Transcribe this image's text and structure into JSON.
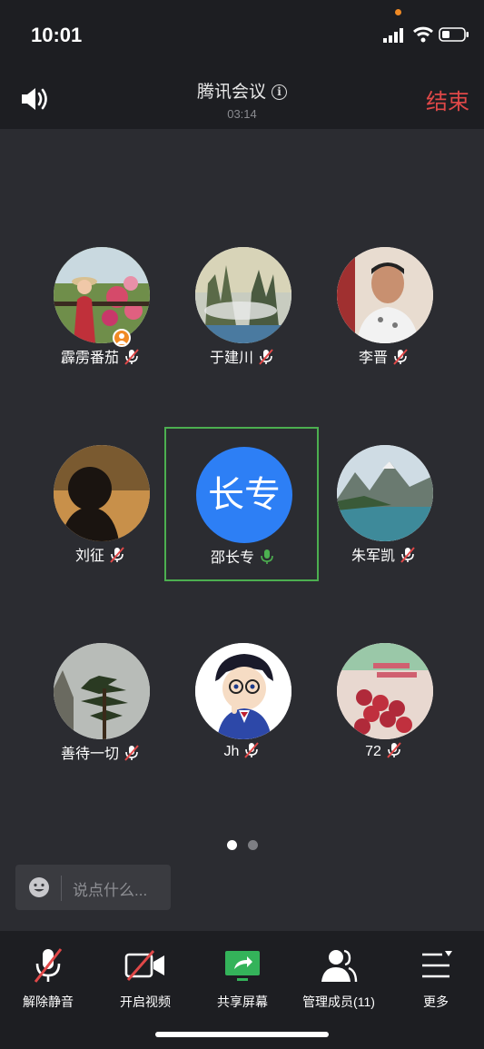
{
  "status_bar": {
    "time": "10:01"
  },
  "header": {
    "title": "腾讯会议",
    "timer": "03:14",
    "end_label": "结束"
  },
  "participants": [
    {
      "name": "霹雳番茄",
      "mic": "muted",
      "host": true
    },
    {
      "name": "于建川",
      "mic": "muted"
    },
    {
      "name": "李晋",
      "mic": "muted"
    },
    {
      "name": "刘征",
      "mic": "muted"
    },
    {
      "name": "邵长专",
      "mic": "on",
      "avatar_text": "长专",
      "speaking": true
    },
    {
      "name": "朱军凯",
      "mic": "muted"
    },
    {
      "name": "善待一切",
      "mic": "muted"
    },
    {
      "name": "Jh",
      "mic": "muted"
    },
    {
      "name": "72",
      "mic": "muted"
    }
  ],
  "pagination": {
    "current": 1,
    "total": 2
  },
  "chat": {
    "placeholder": "说点什么..."
  },
  "toolbar": {
    "unmute": "解除静音",
    "start_video": "开启视频",
    "share_screen": "共享屏幕",
    "manage_members": "管理成员(11)",
    "more": "更多"
  },
  "colors": {
    "background": "#2b2c31",
    "bar": "#1d1e22",
    "end": "#e04848",
    "mute_slash": "#e04848",
    "mic_on": "#4caf50",
    "active_border": "#4caf50",
    "text_avatar": "#2d7ff5",
    "share_screen": "#34b35a"
  }
}
